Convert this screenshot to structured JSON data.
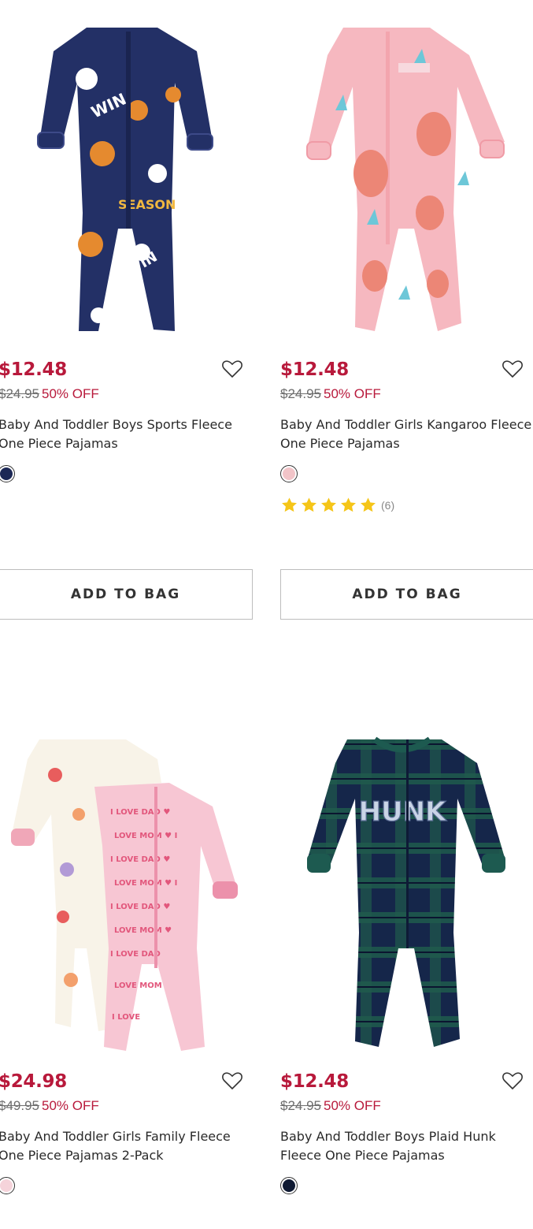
{
  "products": [
    {
      "price": "$12.48",
      "original_price": "$24.95",
      "discount": "50% OFF",
      "name": "Baby And Toddler Boys Sports Fleece One Piece Pajamas",
      "swatch_color": "#1c2856",
      "add_to_bag": "ADD TO BAG",
      "icons": {
        "favorite": "heart-outline-icon"
      }
    },
    {
      "price": "$12.48",
      "original_price": "$24.95",
      "discount": "50% OFF",
      "name": "Baby And Toddler Girls Kangaroo Fleece One Piece Pajamas",
      "swatch_color": "#f2c4c8",
      "rating": {
        "stars": 5,
        "count": "(6)",
        "star_color": "#f5c518"
      },
      "add_to_bag": "ADD TO BAG",
      "icons": {
        "favorite": "heart-outline-icon"
      }
    },
    {
      "price": "$24.98",
      "original_price": "$49.95",
      "discount": "50% OFF",
      "name": "Baby And Toddler Girls Family Fleece One Piece Pajamas 2-Pack",
      "swatch_color": "#f5d3da",
      "icons": {
        "favorite": "heart-outline-icon"
      }
    },
    {
      "price": "$12.48",
      "original_price": "$24.95",
      "discount": "50% OFF",
      "name": "Baby And Toddler Boys Plaid Hunk Fleece One Piece Pajamas",
      "swatch_color": "#0f1a33",
      "image_text": "HUNK",
      "icons": {
        "favorite": "heart-outline-icon"
      }
    }
  ],
  "colors": {
    "sale_red": "#b8193b",
    "strike_gray": "#6d6d6d",
    "button_border": "#bdbdbd"
  }
}
